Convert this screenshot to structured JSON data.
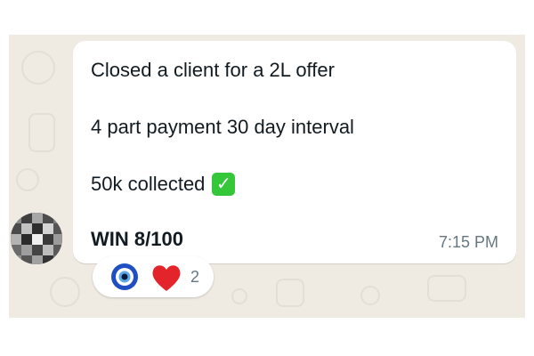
{
  "message": {
    "lines": [
      "Closed a client for a 2L offer",
      "4 part payment 30 day interval",
      "50k collected"
    ],
    "emoji_check": "✓",
    "emoji_check_name": "white-check-mark",
    "win_text": "WIN 8/100",
    "timestamp": "7:15 PM"
  },
  "reactions": {
    "emojis": [
      "nazar-amulet",
      "red-heart"
    ],
    "count": "2"
  },
  "colors": {
    "chat_background": "#efeae2",
    "bubble": "#ffffff",
    "text": "#111b21",
    "meta_text": "#667781",
    "check_green": "#35c73a",
    "heart_red": "#e3242b",
    "nazar_blue": "#1f4fc2"
  }
}
